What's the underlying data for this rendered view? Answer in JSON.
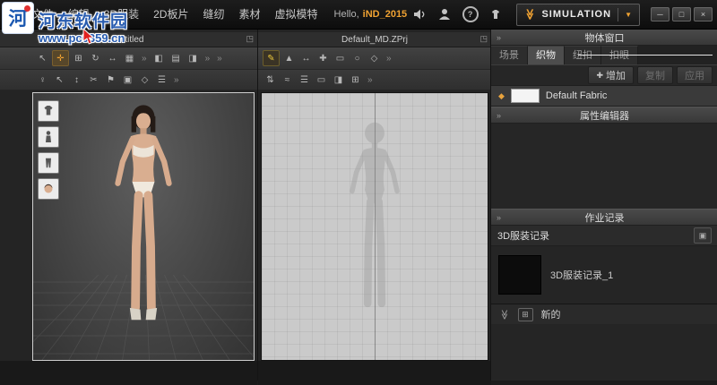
{
  "watermark": {
    "site_name": "河东软件园",
    "site_url": "www.pc0359.cn",
    "logo_char": "河"
  },
  "menubar": {
    "menus": [
      "文件",
      "编辑",
      "3D服装",
      "2D板片",
      "缝纫",
      "素材",
      "虚拟模特"
    ],
    "greeting": "Hello,",
    "username": "iND_2015",
    "simulation_label": "SIMULATION"
  },
  "icons": {
    "help": "?",
    "double_chevron": "≫",
    "dropdown": "▼",
    "minimize": "─",
    "maximize": "□",
    "close": "×",
    "detach": "◳",
    "collapse": "»",
    "overflow": "»",
    "add": "✚",
    "new_box": "⊞",
    "history_tool": "▣",
    "fabric_flag": "◆"
  },
  "toolbars": {
    "v3d_row1": [
      {
        "g": "↖"
      },
      {
        "g": "✛"
      },
      {
        "g": "⊞"
      },
      {
        "g": "↻"
      },
      {
        "g": "↔"
      },
      {
        "g": "▦"
      }
    ],
    "v3d_row1b": [
      {
        "g": "◧"
      },
      {
        "g": "▤"
      },
      {
        "g": "◨"
      }
    ],
    "v3d_row2": [
      {
        "g": "♀"
      },
      {
        "g": "↖"
      },
      {
        "g": "↕"
      },
      {
        "g": "✂"
      },
      {
        "g": "⚑"
      },
      {
        "g": "▣"
      },
      {
        "g": "◇"
      },
      {
        "g": "☰"
      }
    ],
    "p2d_row1": [
      {
        "g": "✎"
      },
      {
        "g": "▲"
      },
      {
        "g": "↔"
      },
      {
        "g": "✚"
      },
      {
        "g": "▭"
      },
      {
        "g": "○"
      },
      {
        "g": "◇"
      }
    ],
    "p2d_row2": [
      {
        "g": "⇅"
      },
      {
        "g": "≈"
      },
      {
        "g": "☰"
      },
      {
        "g": "▭"
      },
      {
        "g": "◨"
      },
      {
        "g": "⊞"
      }
    ]
  },
  "left_panel": {
    "tab_title": "Untitled"
  },
  "center_panel": {
    "tab_title": "Default_MD.ZPrj"
  },
  "right_panel": {
    "object_window": {
      "title": "物体窗口",
      "tabs": [
        "场景",
        "织物",
        "纽扣",
        "扣眼"
      ],
      "active_tab": "织物",
      "buttons": {
        "add": "增加",
        "copy": "复制",
        "apply": "应用"
      },
      "fabric_name": "Default Fabric"
    },
    "property_editor": {
      "title": "属性编辑器"
    },
    "history": {
      "title": "作业记录",
      "section_label": "3D服装记录",
      "item_label": "3D服装记录_1",
      "new_label": "新的"
    }
  }
}
